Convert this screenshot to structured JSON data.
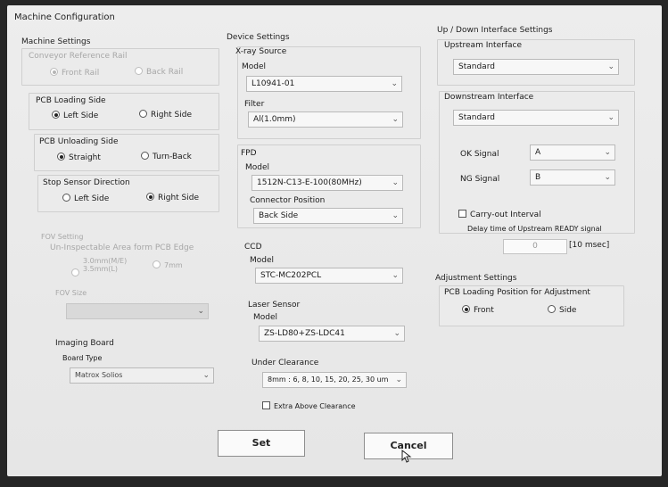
{
  "window": {
    "title": "Machine Configuration"
  },
  "machine": {
    "header": "Machine Settings",
    "conveyor": {
      "label": "Conveyor Reference Rail",
      "front": "Front Rail",
      "back": "Back Rail"
    },
    "loading": {
      "label": "PCB Loading Side",
      "left": "Left Side",
      "right": "Right Side"
    },
    "unloading": {
      "label": "PCB Unloading Side",
      "straight": "Straight",
      "turnback": "Turn-Back"
    },
    "stop": {
      "label": "Stop Sensor Direction",
      "left": "Left Side",
      "right": "Right Side"
    },
    "fov": {
      "label": "FOV Setting",
      "uninspectable": "Un-Inspectable Area form PCB Edge",
      "opt1_line1": "3.0mm(M/E)",
      "opt1_line2": "3.5mm(L)",
      "opt2": "7mm",
      "size_label": "FOV Size"
    },
    "imaging": {
      "header": "Imaging Board",
      "type_label": "Board Type",
      "type_value": "Matrox Solios"
    }
  },
  "device": {
    "header": "Device Settings",
    "xray": {
      "label": "X-ray Source",
      "model_label": "Model",
      "model_value": "L10941-01",
      "filter_label": "Filter",
      "filter_value": "Al(1.0mm)"
    },
    "fpd": {
      "label": "FPD",
      "model_label": "Model",
      "model_value": "1512N-C13-E-100(80MHz)",
      "connector_label": "Connector Position",
      "connector_value": "Back Side"
    },
    "ccd": {
      "label": "CCD",
      "model_label": "Model",
      "model_value": "STC-MC202PCL"
    },
    "laser": {
      "label": "Laser Sensor",
      "model_label": "Model",
      "model_value": "ZS-LD80+ZS-LDC41"
    },
    "clearance": {
      "label": "Under Clearance",
      "value": "8mm : 6, 8, 10, 15, 20, 25, 30 um",
      "extra": "Extra Above Clearance"
    }
  },
  "updown": {
    "header": "Up / Down Interface Settings",
    "upstream_label": "Upstream Interface",
    "upstream_value": "Standard",
    "downstream_label": "Downstream Interface",
    "downstream_value": "Standard",
    "ok_label": "OK Signal",
    "ok_value": "A",
    "ng_label": "NG Signal",
    "ng_value": "B",
    "carry_label": "Carry-out Interval",
    "delay_label": "Delay time of Upstream READY signal",
    "delay_value": "0",
    "delay_unit": "[10 msec]"
  },
  "adjustment": {
    "header": "Adjustment Settings",
    "position_label": "PCB Loading Position for Adjustment",
    "front": "Front",
    "side": "Side"
  },
  "buttons": {
    "set": "Set",
    "cancel": "Cancel"
  },
  "icons": {
    "dropdown": "chevron-down-icon",
    "cursor": "mouse-pointer-icon"
  }
}
